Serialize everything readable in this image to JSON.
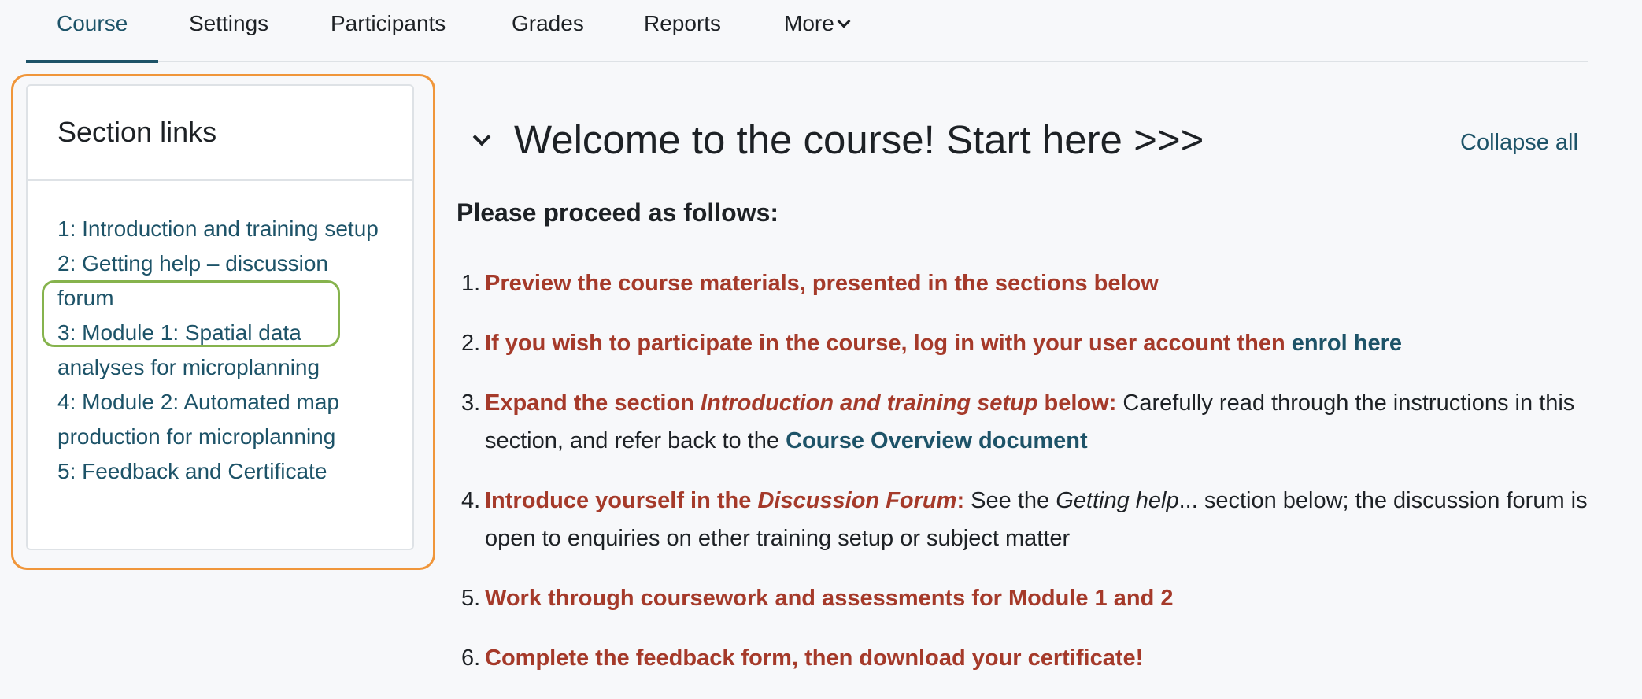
{
  "nav": {
    "tabs": [
      {
        "label": "Course",
        "active": true
      },
      {
        "label": "Settings"
      },
      {
        "label": "Participants"
      },
      {
        "label": "Grades"
      },
      {
        "label": "Reports"
      },
      {
        "label": "More",
        "has_dropdown": true
      }
    ]
  },
  "sidebar": {
    "title": "Section links",
    "links": [
      {
        "label": "1: Introduction and training setup"
      },
      {
        "label": "2: Getting help – discussion forum",
        "highlighted": true
      },
      {
        "label": "3: Module 1: Spatial data analyses for microplanning"
      },
      {
        "label": "4: Module 2: Automated map production for microplanning"
      },
      {
        "label": "5: Feedback and Certificate"
      }
    ]
  },
  "main": {
    "section_title": "Welcome to the course! Start here >>>",
    "collapse_all": "Collapse all",
    "intro": "Please proceed as follows:",
    "steps": [
      {
        "num": "1.",
        "parts": {
          "red": "Preview the course materials, presented in the sections below"
        }
      },
      {
        "num": "2.",
        "parts": {
          "red": "If you wish to participate in the course, log in with your user account then ",
          "link": "enrol here"
        }
      },
      {
        "num": "3.",
        "parts": {
          "red_a": "Expand the section ",
          "red_italic": "Introduction and training setup",
          "red_b": " below:",
          "plain": " Carefully read through the instructions in this section, and refer back to the ",
          "link": "Course Overview document"
        }
      },
      {
        "num": "4.",
        "parts": {
          "red_a": "Introduce yourself in the ",
          "red_italic": "Discussion Forum",
          "red_b": ":",
          "plain_a": " See the ",
          "plain_italic": "Getting help",
          "plain_b": "... section below; the discussion forum is open to enquiries on ether training setup or subject matter"
        }
      },
      {
        "num": "5.",
        "parts": {
          "red": "Work through coursework and assessments for Module 1 and 2"
        }
      },
      {
        "num": "6.",
        "parts": {
          "red": "Complete the feedback form, then download your certificate!"
        }
      }
    ]
  },
  "colors": {
    "accent": "#1d5368",
    "emphasis_red": "#a53a2a",
    "annotation_orange": "#f0963a",
    "annotation_green": "#86b34d"
  }
}
